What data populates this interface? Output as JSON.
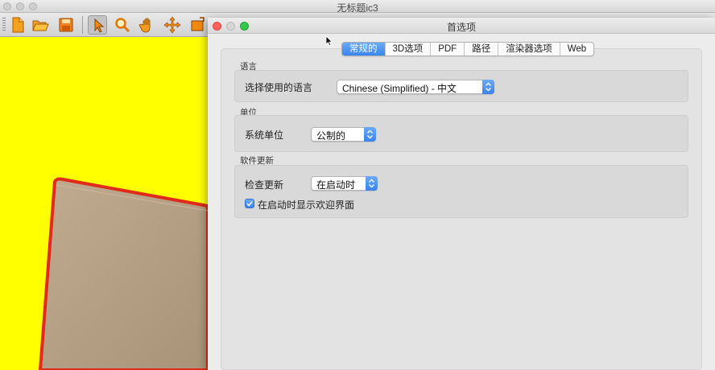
{
  "app": {
    "title": "无标题ic3",
    "toolbar": [
      "new-file-icon",
      "open-folder-icon",
      "save-icon",
      "select-arrow-icon",
      "zoom-icon",
      "pan-hand-icon",
      "move-icon",
      "frame-icon"
    ]
  },
  "prefs": {
    "title": "首选项",
    "tabs": [
      "常规的",
      "3D选项",
      "PDF",
      "路径",
      "渲染器选项",
      "Web"
    ],
    "active_tab": "常规的",
    "language": {
      "section": "语言",
      "label": "选择使用的语言",
      "value": "Chinese (Simplified) - 中文"
    },
    "units": {
      "section": "单位",
      "label": "系统单位",
      "value": "公制的"
    },
    "update": {
      "section": "软件更新",
      "label": "检查更新",
      "value": "在启动时",
      "checkbox_label": "在启动时显示欢迎界面",
      "checkbox_checked": true
    }
  },
  "colors": {
    "canvas": "#ffff00",
    "shape_fill": "#b4a088",
    "shape_outline": "#e02a1a",
    "accent": "#3a85ee"
  }
}
